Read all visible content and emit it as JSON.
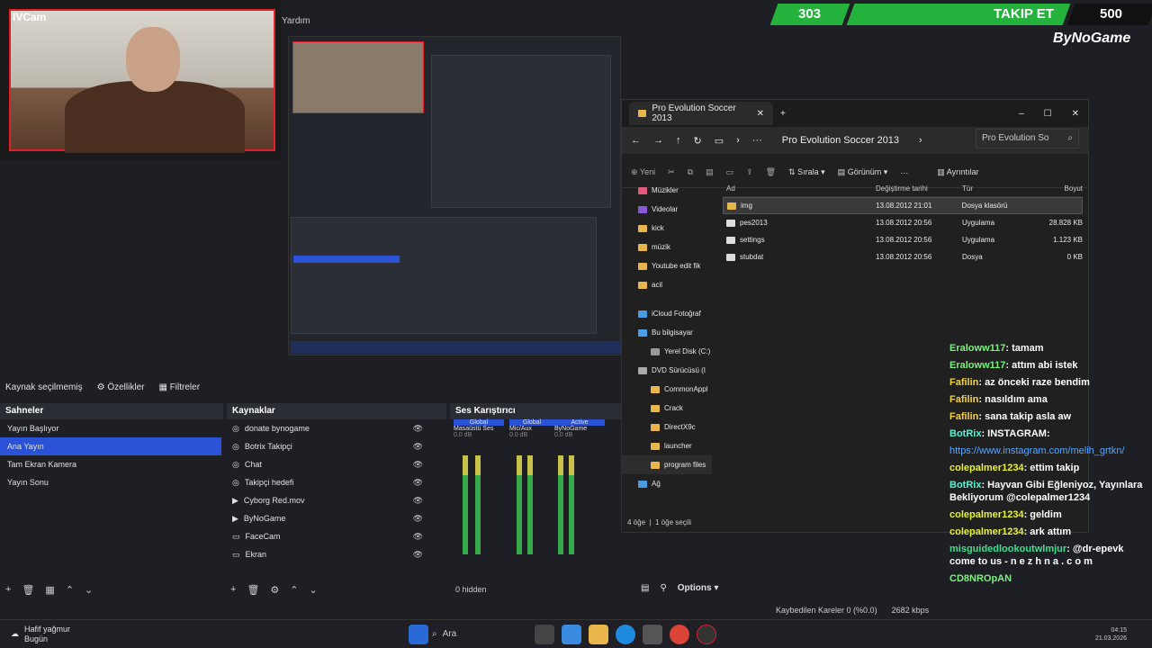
{
  "webcam": {
    "tag": "IVCam"
  },
  "menu": {
    "help": "Yardım"
  },
  "banner": {
    "left_num": "303",
    "follow": "TAKIP ET",
    "right_num": "500"
  },
  "brand": "ByNoGame",
  "explorer": {
    "tab_title": "Pro Evolution Soccer 2013",
    "address": "Pro Evolution Soccer 2013",
    "search_placeholder": "Pro Evolution So",
    "toolbar": {
      "new": "Yeni",
      "sort": "Sırala",
      "view": "Görünüm",
      "details": "Ayrıntılar"
    },
    "sidebar": [
      "Müzikler",
      "Videolar",
      "kick",
      "müzik",
      "Youtube edit fik",
      "acil",
      "iCloud Fotoğraf",
      "Bu bilgisayar",
      "Yerel Disk (C:)",
      "DVD Sürücüsü (I",
      "CommonAppl",
      "Crack",
      "DirectX9c",
      "launcher",
      "program files",
      "Ağ"
    ],
    "columns": [
      "Ad",
      "Değiştirme tarihi",
      "Tür",
      "Boyut"
    ],
    "files": [
      {
        "name": "img",
        "date": "13.08.2012 21:01",
        "type": "Dosya klasörü",
        "size": ""
      },
      {
        "name": "pes2013",
        "date": "13.08.2012 20:56",
        "type": "Uygulama",
        "size": "28.828 KB"
      },
      {
        "name": "settings",
        "date": "13.08.2012 20:56",
        "type": "Uygulama",
        "size": "1.123 KB"
      },
      {
        "name": "stubdat",
        "date": "13.08.2012 20:56",
        "type": "Dosya",
        "size": "0 KB"
      }
    ],
    "status_count": "4 öğe",
    "status_sel": "1 öğe seçili"
  },
  "obs": {
    "no_source": "Kaynak seçilmemiş",
    "properties": "Özellikler",
    "filters": "Filtreler",
    "scenes_title": "Sahneler",
    "scenes": [
      "Yayın Başlıyor",
      "Ana Yayın",
      "Tam Ekran Kamera",
      "Yayın Sonu"
    ],
    "sources_title": "Kaynaklar",
    "sources": [
      "donate bynogame",
      "Botrix Takipçi",
      "Chat",
      "Takipçi hedefi",
      "Cyborg Red.mov",
      "ByNoGame",
      "FaceCam",
      "Ekran"
    ],
    "mixer_title": "Ses Karıştırıcı",
    "mixer_ch": [
      "Masaüstü Ses",
      "Mic/Aux",
      "ByNoGame"
    ],
    "mixer_db": [
      "0.0 dB",
      "0.0 dB",
      "0.0 dB"
    ],
    "mixer_tags": [
      "Global",
      "Global",
      "Active"
    ],
    "hidden": "0 hidden",
    "options": "Options",
    "dropped": "Kaybedilen Kareler 0 (%0.0)",
    "bitrate": "2682 kbps"
  },
  "chat": [
    {
      "user": "Eraloww117",
      "text": ": tamam",
      "cls": "u1"
    },
    {
      "user": "Eraloww117",
      "text": ": attım abi istek",
      "cls": "u1"
    },
    {
      "user": "Fafilin",
      "text": ": az önceki raze bendim",
      "cls": "u2"
    },
    {
      "user": "Fafilin",
      "text": ": nasıldım ama",
      "cls": "u2"
    },
    {
      "user": "Fafilin",
      "text": ": sana takip asla aw",
      "cls": "u2"
    },
    {
      "user": "BotRix",
      "text": ": INSTAGRAM:",
      "cls": "u3"
    },
    {
      "user": "",
      "text": "https://www.instagram.com/melih_grtkn/",
      "cls": "link"
    },
    {
      "user": "colepalmer1234",
      "text": ": ettim takip",
      "cls": "u4"
    },
    {
      "user": "BotRix",
      "text": ": Hayvan Gibi Eğleniyoz, Yayınlara Bekliyorum @colepalmer1234",
      "cls": "u3"
    },
    {
      "user": "colepalmer1234",
      "text": ": geldim",
      "cls": "u4"
    },
    {
      "user": "colepalmer1234",
      "text": ": ark attım",
      "cls": "u4"
    },
    {
      "user": "misguidedlookoutwlmjur",
      "text": ": @dr-epevk come to us - n e z h n a . c o m",
      "cls": "u5"
    },
    {
      "user": "",
      "text": "CD8NROpAN",
      "cls": "u1"
    }
  ],
  "taskbar": {
    "weather": "Hafif yağmur",
    "weather_sub": "Bugün",
    "search": "Ara",
    "time": "04:15",
    "date": "21.03.2026"
  }
}
